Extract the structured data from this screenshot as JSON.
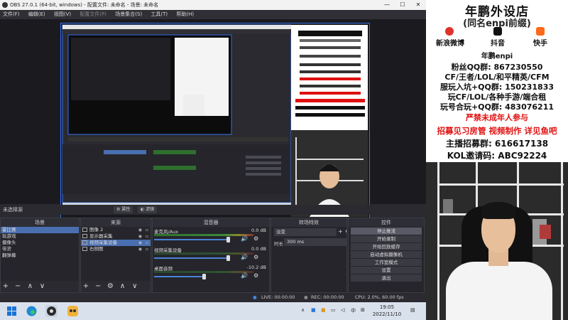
{
  "window": {
    "title": "OBS 27.0.1 (64-bit, windows) - 配置文件: 未命名 - 场景: 未命名",
    "minimize": "—",
    "maximize": "☐",
    "close": "✕"
  },
  "menu": {
    "items": [
      "文件(F)",
      "编辑(E)",
      "视图(V)",
      "配置文件(P)",
      "场景集合(S)",
      "工具(T)",
      "帮助(H)"
    ]
  },
  "status_row": {
    "scene_label": "未选择源",
    "properties": "属性",
    "filters": "滤镜"
  },
  "docks": {
    "scenes": {
      "title": "场景",
      "items": [
        "霍比赛",
        "玩游戏",
        "摄像头",
        "带货",
        "翻弹幕"
      ],
      "selected": 0
    },
    "sources": {
      "title": "来源",
      "items": [
        "图像 2",
        "显示器采集",
        "视频采集设备",
        "右侧图"
      ],
      "selected": 2
    },
    "mixer": {
      "title": "混音器",
      "channels": [
        {
          "name": "麦克风/Aux",
          "db": "0.0 dB"
        },
        {
          "name": "视频采集设备",
          "db": "0.0 dB"
        },
        {
          "name": "桌面音频",
          "db": "-10.2 dB"
        }
      ]
    },
    "transitions": {
      "title": "转场特效",
      "selected": "淡变",
      "duration_label": "时长",
      "duration_value": "300 ms"
    },
    "controls": {
      "title": "控件",
      "buttons": [
        "停止推流",
        "开始录制",
        "开始回放缓存",
        "启动虚拟摄像机",
        "工作室模式",
        "设置",
        "退出"
      ]
    },
    "footer": {
      "add": "+",
      "remove": "−",
      "up": "∧",
      "down": "∨",
      "gear": "⚙"
    }
  },
  "statusbar": {
    "live": "LIVE: 00:00:00",
    "rec": "REC: 00:00:00",
    "cpu": "CPU: 2.0%, 60.00 fps"
  },
  "taskbar": {
    "time": "19:05",
    "date": "2022/11/10",
    "ime": "中",
    "tray_up": "∧"
  },
  "promo": {
    "shop_title": "年鹏外设店",
    "shop_subtitle": "(同名enpi前缀)",
    "platforms": [
      "新浪微博",
      "抖音",
      "快手"
    ],
    "handle": "年鹏enpi",
    "fan_group": "粉丝QQ群: 867230550",
    "games": "CF/王者/LOL/和平精英/CFM",
    "win_group": "服玩入坑+QQ群: 150231833",
    "play_games": "玩CF/LOL/各种手游/端合租",
    "play_group": "玩号合玩+QQ群: 483076211",
    "warning": "严禁未成年人参与",
    "recruit": "招募见习房管 视频制作 详见鱼吧",
    "anchor_group": "主播招募群: 616617138",
    "kol_code": "KOL邀请码: ABC92224"
  },
  "colors": {
    "obs_bg": "#2a2a30",
    "accent": "#4a82d8",
    "warning_red": "#e01010",
    "recruit_red": "#e01010"
  }
}
